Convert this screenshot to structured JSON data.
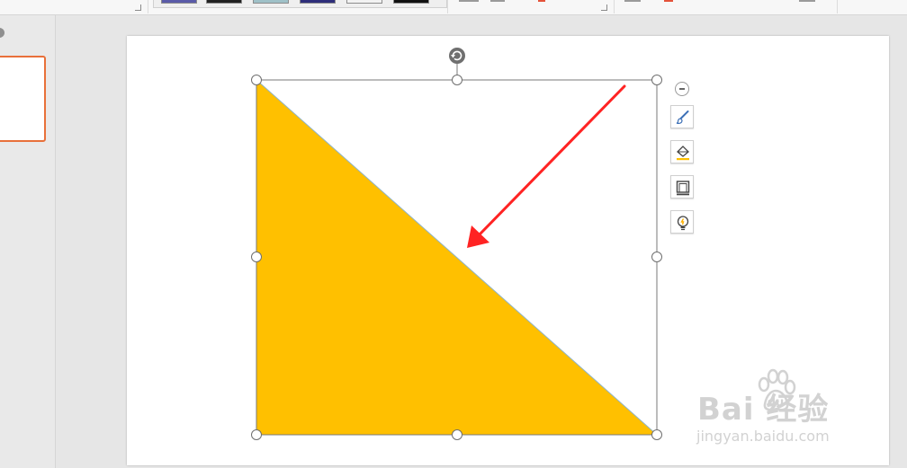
{
  "app": {
    "name": "presentation-editor"
  },
  "ribbon": {
    "visible_state": "clipped-at-top"
  },
  "thumbnails": [
    {
      "selected": true
    }
  ],
  "slide": {
    "background": "#ffffff",
    "shape": {
      "type": "right-triangle",
      "fill": "#ffc000",
      "outline": "#8fb4c8",
      "selected": true
    }
  },
  "selection": {
    "border_color": "#7a7a7a",
    "handle_fill": "#ffffff",
    "handle_stroke": "#6f6f6f",
    "rotate_handle_color": "#6f6f6f"
  },
  "annotation": {
    "type": "arrow",
    "color": "#ff2323"
  },
  "quick_toolbar": {
    "buttons": [
      {
        "icon": "minus-circle-icon",
        "role": "collapse"
      },
      {
        "icon": "brush-icon",
        "role": "shape-style"
      },
      {
        "icon": "fill-bucket-icon",
        "role": "shape-fill"
      },
      {
        "icon": "frame-outline-icon",
        "role": "shape-outline"
      },
      {
        "icon": "lightbulb-icon",
        "role": "smart-suggestions"
      }
    ]
  },
  "watermark": {
    "logo_text": "Bai  经验",
    "url": "jingyan.baidu.com",
    "color": "#d2d2d2"
  },
  "colors": {
    "accent_thumb_border": "#e8703a",
    "workspace_bg": "#e6e6e6"
  }
}
